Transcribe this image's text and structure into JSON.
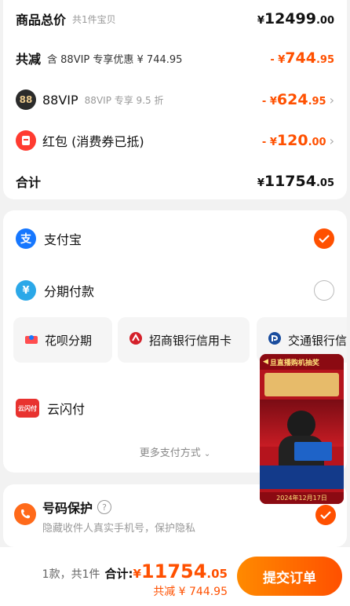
{
  "summary": {
    "total_label": "商品总价",
    "item_count": "共1件宝贝",
    "total_currency": "¥",
    "total_int": "12499",
    "total_dec": ".00",
    "discount_label": "共减",
    "discount_desc": "含 88VIP 专享优惠 ¥ 744.95",
    "discount_prefix": "- ¥",
    "discount_int": "744",
    "discount_dec": ".95",
    "vip_icon_text": "88",
    "vip_label": "88VIP",
    "vip_sub": "88VIP 专享 9.5 折",
    "vip_prefix": "- ¥",
    "vip_int": "624",
    "vip_dec": ".95",
    "redpacket_label": "红包 (消费券已抵)",
    "redpacket_prefix": "- ¥",
    "redpacket_int": "120",
    "redpacket_dec": ".00",
    "sum_label": "合计",
    "sum_currency": "¥",
    "sum_int": "11754",
    "sum_dec": ".05"
  },
  "payment": {
    "alipay": "支付宝",
    "alipay_icon_text": "支",
    "installment": "分期付款",
    "installment_icon_text": "¥",
    "chips": [
      "花呗分期",
      "招商银行信用卡",
      "交通银行信用卡"
    ],
    "unionpay": "云闪付",
    "unionpay_icon_text": "云闪付",
    "more": "更多支付方式"
  },
  "privacy": {
    "title": "号码保护",
    "desc": "隐藏收件人真实手机号，保护隐私",
    "help": "?"
  },
  "video": {
    "banner": "旦直播购机抽奖",
    "date": "2024年12月17日"
  },
  "bottom": {
    "count": "1款，共1件",
    "total_label": "合计:",
    "total_currency": "¥",
    "total_int": "11754",
    "total_dec": ".05",
    "discount": "共减 ¥ 744.95",
    "submit": "提交订单"
  },
  "colors": {
    "accent": "#ff5000",
    "alipay": "#1677ff"
  }
}
